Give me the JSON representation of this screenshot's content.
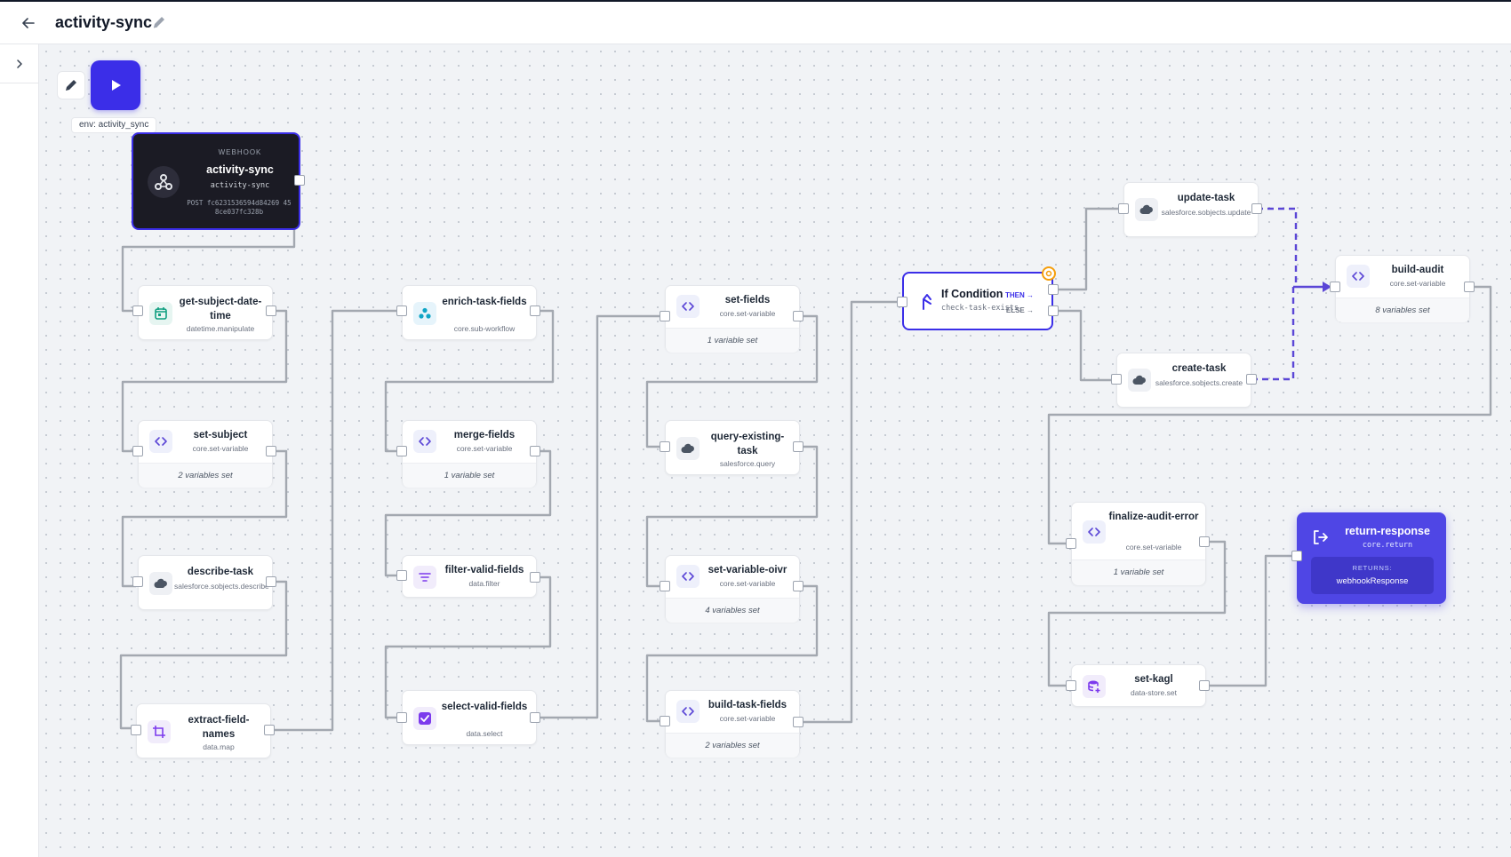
{
  "header": {
    "title": "activity-sync"
  },
  "canvas": {
    "env_label": "env: activity_sync"
  },
  "webhook": {
    "kind": "WEBHOOK",
    "name": "activity-sync",
    "code": "activity-sync",
    "url": "POST fc6231536594d84269 458ce037fc328b"
  },
  "nodes": {
    "get_subject_date_time": {
      "name": "get-subject-date-time",
      "type": "datetime.manipulate"
    },
    "set_subject": {
      "name": "set-subject",
      "type": "core.set-variable",
      "sub": "2 variables set"
    },
    "describe_task": {
      "name": "describe-task",
      "type": "salesforce.sobjects.describe"
    },
    "extract_field_names": {
      "name": "extract-field-names",
      "type": "data.map"
    },
    "enrich_task_fields": {
      "name": "enrich-task-fields",
      "type": "core.sub-workflow"
    },
    "merge_fields": {
      "name": "merge-fields",
      "type": "core.set-variable",
      "sub": "1 variable set"
    },
    "filter_valid_fields": {
      "name": "filter-valid-fields",
      "type": "data.filter"
    },
    "select_valid_fields": {
      "name": "select-valid-fields",
      "type": "data.select"
    },
    "set_fields": {
      "name": "set-fields",
      "type": "core.set-variable",
      "sub": "1 variable set"
    },
    "query_existing_task": {
      "name": "query-existing-task",
      "type": "salesforce.query"
    },
    "set_variable_oivr": {
      "name": "set-variable-oivr",
      "type": "core.set-variable",
      "sub": "4 variables set"
    },
    "build_task_fields": {
      "name": "build-task-fields",
      "type": "core.set-variable",
      "sub": "2 variables set"
    },
    "update_task": {
      "name": "update-task",
      "type": "salesforce.sobjects.update"
    },
    "create_task": {
      "name": "create-task",
      "type": "salesforce.sobjects.create"
    },
    "build_audit": {
      "name": "build-audit",
      "type": "core.set-variable",
      "sub": "8 variables set"
    },
    "finalize_audit_error": {
      "name": "finalize-audit-error",
      "type": "core.set-variable",
      "sub": "1 variable set"
    },
    "set_kagl": {
      "name": "set-kagl",
      "type": "data-store.set"
    }
  },
  "condition": {
    "name": "If Condition",
    "id": "check-task-exists",
    "then_label": "THEN →",
    "else_label": "ELSE →"
  },
  "return_node": {
    "name": "return-response",
    "code": "core.return",
    "returns_label": "RETURNS:",
    "returns_value": "webhookResponse"
  },
  "colors": {
    "accent": "#3b2ee8",
    "return_bg": "#4f46e5",
    "edge": "#9ca3af",
    "dashed_edge": "#5b46d6",
    "webhook_bg": "#1b1b24"
  }
}
